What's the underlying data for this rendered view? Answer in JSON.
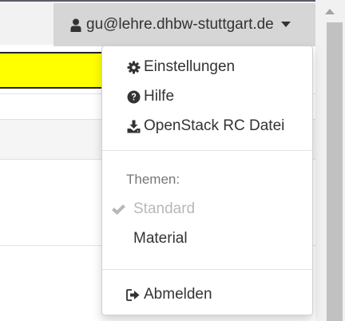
{
  "navbar": {
    "user_email": "gu@lehre.dhbw-stuttgart.de",
    "user_icon": "user-icon",
    "caret_icon": "caret-down-icon"
  },
  "dropdown": {
    "items": [
      {
        "label": "Einstellungen",
        "icon": "gear-icon"
      },
      {
        "label": "Hilfe",
        "icon": "question-circle-icon"
      },
      {
        "label": "OpenStack RC Datei",
        "icon": "download-icon"
      }
    ],
    "themes_header": "Themen:",
    "themes": [
      {
        "label": "Standard",
        "selected": true,
        "icon": "check-icon"
      },
      {
        "label": "Material",
        "selected": false
      }
    ],
    "logout_label": "Abmelden",
    "logout_icon": "sign-out-icon"
  },
  "colors": {
    "banner_yellow": "#ffff00",
    "toggle_bg": "#d6d6d6",
    "text": "#333333",
    "disabled_text": "#b8b8b8",
    "header_text": "#777777"
  }
}
